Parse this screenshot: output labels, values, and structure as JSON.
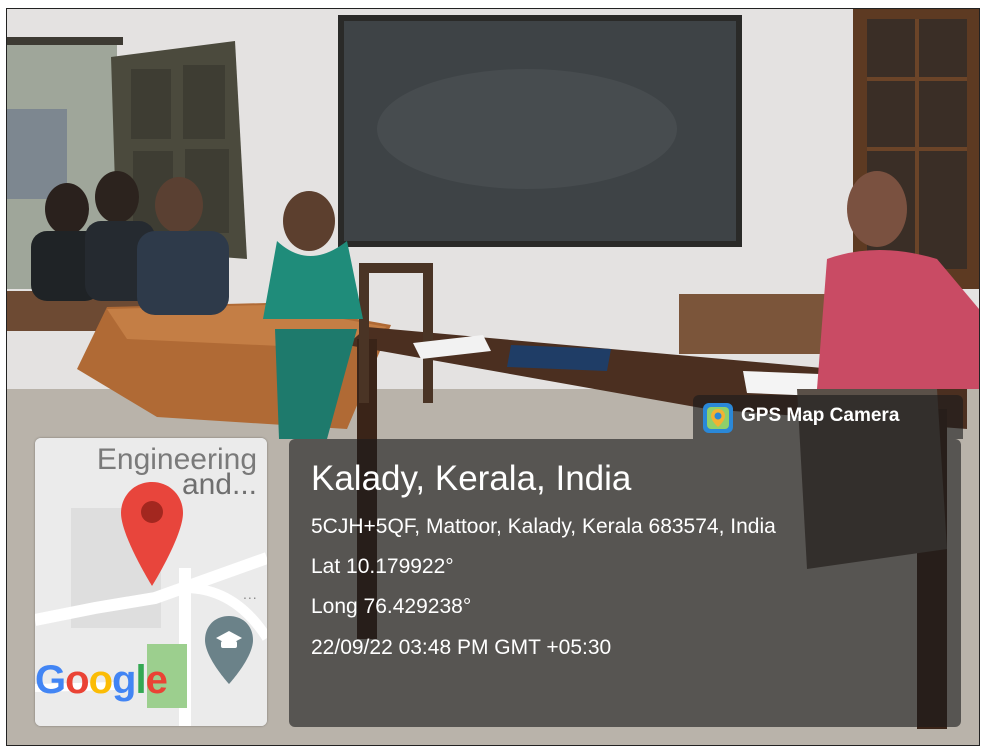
{
  "badge": {
    "label": "GPS Map Camera",
    "icon": "gps-map-camera-icon"
  },
  "location": {
    "title": "Kalady, Kerala, India",
    "address": "5CJH+5QF, Mattoor, Kalady, Kerala 683574, India",
    "lat": "Lat 10.179922°",
    "long": "Long 76.429238°",
    "datetime": "22/09/22 03:48 PM GMT +05:30"
  },
  "map": {
    "road_label_1": "Engineering",
    "road_label_2": "and...",
    "ellipsis": "...",
    "pin_color": "#e8453c",
    "brand_letters": [
      "G",
      "o",
      "o",
      "g",
      "l",
      "e"
    ]
  }
}
